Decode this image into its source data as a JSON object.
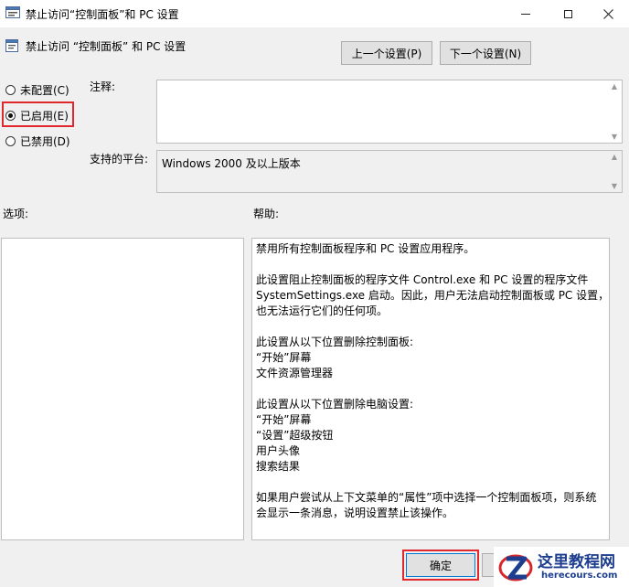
{
  "window": {
    "title": "禁止访问“控制面板”和 PC 设置",
    "icon": "policy-icon"
  },
  "header": {
    "setting_name": "禁止访问 “控制面板” 和 PC 设置",
    "prev_button": "上一个设置(P)",
    "next_button": "下一个设置(N)"
  },
  "state": {
    "options": [
      {
        "label": "未配置(C)",
        "checked": false
      },
      {
        "label": "已启用(E)",
        "checked": true
      },
      {
        "label": "已禁用(D)",
        "checked": false
      }
    ]
  },
  "labels": {
    "comment": "注释:",
    "platform": "支持的平台:",
    "options": "选项:",
    "help": "帮助:"
  },
  "comment_value": "",
  "platform_value": "Windows 2000 及以上版本",
  "help_text": [
    "禁用所有控制面板程序和 PC 设置应用程序。",
    "",
    "此设置阻止控制面板的程序文件 Control.exe 和 PC 设置的程序文件",
    "SystemSettings.exe 启动。因此，用户无法启动控制面板或 PC 设置，",
    "也无法运行它们的任何项。",
    "",
    "此设置从以下位置删除控制面板:",
    "“开始”屏幕",
    "文件资源管理器",
    "",
    "此设置从以下位置删除电脑设置:",
    "“开始”屏幕",
    "“设置”超级按钮",
    "用户头像",
    "搜索结果",
    "",
    "如果用户尝试从上下文菜单的“属性”项中选择一个控制面板项，则系统",
    "会显示一条消息，说明设置禁止该操作。"
  ],
  "footer": {
    "ok_button": "确定",
    "cancel_button": ""
  },
  "watermark": {
    "name": "这里教程网",
    "domain": "herecours.com"
  },
  "colors": {
    "highlight": "#e0282e",
    "watermark_blue": "#1d3d8f",
    "ok_border": "#0078d7"
  }
}
